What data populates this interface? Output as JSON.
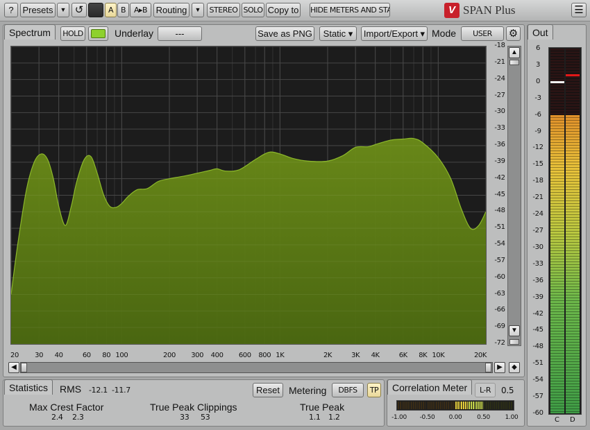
{
  "toolbar": {
    "help": "?",
    "presets": "Presets",
    "presets_arrow": "▼",
    "undo": "↺",
    "a": "A",
    "b": "B",
    "ab": "A▸B",
    "routing": "Routing",
    "routing_arrow": "▼",
    "stereo": "STEREO",
    "solo": "SOLO",
    "copy_to": "Copy to",
    "hide_meters": "HIDE METERS AND STATS",
    "brand_logo": "V",
    "brand": "SPAN Plus",
    "menu": "☰"
  },
  "spectrum": {
    "tab": "Spectrum",
    "hold": "HOLD",
    "underlay_label": "Underlay",
    "underlay_value": "---",
    "save_png": "Save as PNG",
    "static": "Static ▾",
    "import_export": "Import/Export ▾",
    "mode_label": "Mode",
    "mode_value": "USER",
    "settings_icon": "⚙",
    "colors": {
      "fill": "#5b7a14",
      "line": "#8cb82a",
      "bg": "#1c1c1c"
    }
  },
  "chart_data": {
    "type": "area",
    "title": "",
    "xlabel": "",
    "ylabel": "",
    "x_scale": "log",
    "xlim": [
      20,
      20000
    ],
    "ylim": [
      -72,
      -18
    ],
    "x_ticks": [
      "20",
      "30",
      "40",
      "60",
      "80",
      "100",
      "200",
      "300",
      "400",
      "600",
      "800",
      "1K",
      "2K",
      "3K",
      "4K",
      "6K",
      "8K",
      "10K",
      "20K"
    ],
    "x_tick_values": [
      20,
      30,
      40,
      60,
      80,
      100,
      200,
      300,
      400,
      600,
      800,
      1000,
      2000,
      3000,
      4000,
      6000,
      8000,
      10000,
      20000
    ],
    "y_ticks": [
      "-18",
      "-21",
      "-24",
      "-27",
      "-30",
      "-33",
      "-36",
      "-39",
      "-42",
      "-45",
      "-48",
      "-51",
      "-54",
      "-57",
      "-60",
      "-63",
      "-66",
      "-69",
      "-72"
    ],
    "y_tick_values": [
      -18,
      -21,
      -24,
      -27,
      -30,
      -33,
      -36,
      -39,
      -42,
      -45,
      -48,
      -51,
      -54,
      -57,
      -60,
      -63,
      -66,
      -69,
      -72
    ],
    "grid": true,
    "series": [
      {
        "x": [
          20,
          22,
          25,
          28,
          31,
          34,
          37,
          40,
          44,
          48,
          52,
          58,
          64,
          70,
          77,
          84,
          92,
          100,
          110,
          125,
          145,
          170,
          200,
          250,
          300,
          360,
          400,
          450,
          550,
          700,
          850,
          1000,
          1200,
          1500,
          2000,
          2500,
          3000,
          3600,
          4000,
          5000,
          6000,
          7000,
          8000,
          10000,
          12000,
          14000,
          16000,
          18000,
          20000
        ],
        "y": [
          -63,
          -54,
          -44,
          -39,
          -37.5,
          -38.5,
          -42,
          -47,
          -50.5,
          -47,
          -42.5,
          -38.5,
          -38,
          -41,
          -45,
          -47,
          -47.2,
          -46.5,
          -45.2,
          -44,
          -43.8,
          -42.5,
          -42,
          -41.5,
          -41,
          -40.5,
          -40.2,
          -40.6,
          -40.4,
          -38.5,
          -37.2,
          -37.5,
          -38.3,
          -38.8,
          -38.8,
          -37.8,
          -36.3,
          -36.2,
          -35.8,
          -35,
          -34.8,
          -34.7,
          -35.5,
          -38.2,
          -42,
          -47.5,
          -51,
          -50.5,
          -48
        ]
      }
    ]
  },
  "meter": {
    "tab": "Out",
    "scale": [
      "6",
      "3",
      "0",
      "-3",
      "-6",
      "-9",
      "-12",
      "-15",
      "-18",
      "-21",
      "-24",
      "-27",
      "-30",
      "-33",
      "-36",
      "-39",
      "-42",
      "-45",
      "-48",
      "-51",
      "-54",
      "-57",
      "-60"
    ],
    "scale_values": [
      6,
      3,
      0,
      -3,
      -6,
      -9,
      -12,
      -15,
      -18,
      -21,
      -24,
      -27,
      -30,
      -33,
      -36,
      -39,
      -42,
      -45,
      -48,
      -51,
      -54,
      -57,
      -60
    ],
    "range": [
      -60,
      6
    ],
    "channels": [
      {
        "label": "C",
        "level_db": -6,
        "peak_db": 0
      },
      {
        "label": "D",
        "level_db": -6,
        "peak_db": 1.2
      }
    ]
  },
  "statistics": {
    "tab": "Statistics",
    "rms_label": "RMS",
    "rms_l": "-12.1",
    "rms_r": "-11.7",
    "reset": "Reset",
    "metering_label": "Metering",
    "metering_value": "DBFS",
    "tp": "TP",
    "crest_label": "Max Crest Factor",
    "crest_l": "2.4",
    "crest_r": "2.3",
    "clip_label": "True Peak Clippings",
    "clip_l": "33",
    "clip_r": "53",
    "tpeak_label": "True Peak",
    "tpeak_l": "1.1",
    "tpeak_r": "1.2"
  },
  "correlation": {
    "tab": "Correlation Meter",
    "mode": "L-R",
    "value": "0.5",
    "value_num": 0.5,
    "scale": [
      "-1.00",
      "-0.50",
      "0.00",
      "0.50",
      "1.00"
    ]
  }
}
